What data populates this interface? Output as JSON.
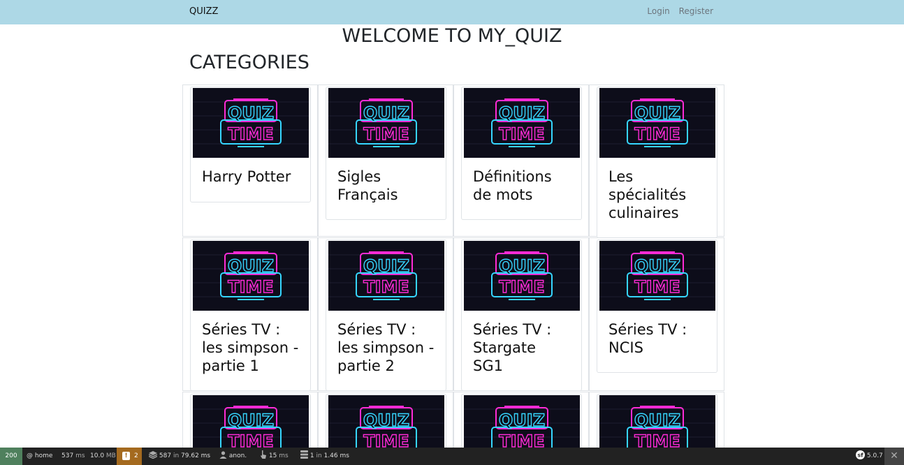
{
  "navbar": {
    "brand": "QUIZZ",
    "login": "Login",
    "register": "Register"
  },
  "page": {
    "welcome": "WELCOME TO MY_QUIZ",
    "categories_heading": "CATEGORIES"
  },
  "thumbnail": {
    "line1": "QUIZ",
    "line2": "TIME"
  },
  "categories": [
    "Harry Potter",
    "Sigles Français",
    "Définitions de mots",
    "Les spécialités culinaires",
    "Séries TV : les simpson - partie 1",
    "Séries TV : les simpson - partie 2",
    "Séries TV : Stargate SG1",
    "Séries TV : NCIS",
    "",
    "",
    "",
    ""
  ],
  "toolbar": {
    "status": "200",
    "route": "@ home",
    "time": "537",
    "time_unit": "ms",
    "memory": "10.0",
    "memory_unit": "MB",
    "warnings": "2",
    "cache": "587",
    "cache_in": "in",
    "cache_time": "79.62 ms",
    "user": "anon.",
    "events_time": "15",
    "events_unit": "ms",
    "db": "1",
    "db_in": "in",
    "db_time": "1.46 ms",
    "version": "5.0.7",
    "close": "✕"
  },
  "colors": {
    "navbar": "#add8e6",
    "toolbar": "#222222",
    "status_ok": "#4f805d",
    "warning": "#a46a1f",
    "neon_pink": "#ff2bd6",
    "neon_cyan": "#36d6ff"
  }
}
